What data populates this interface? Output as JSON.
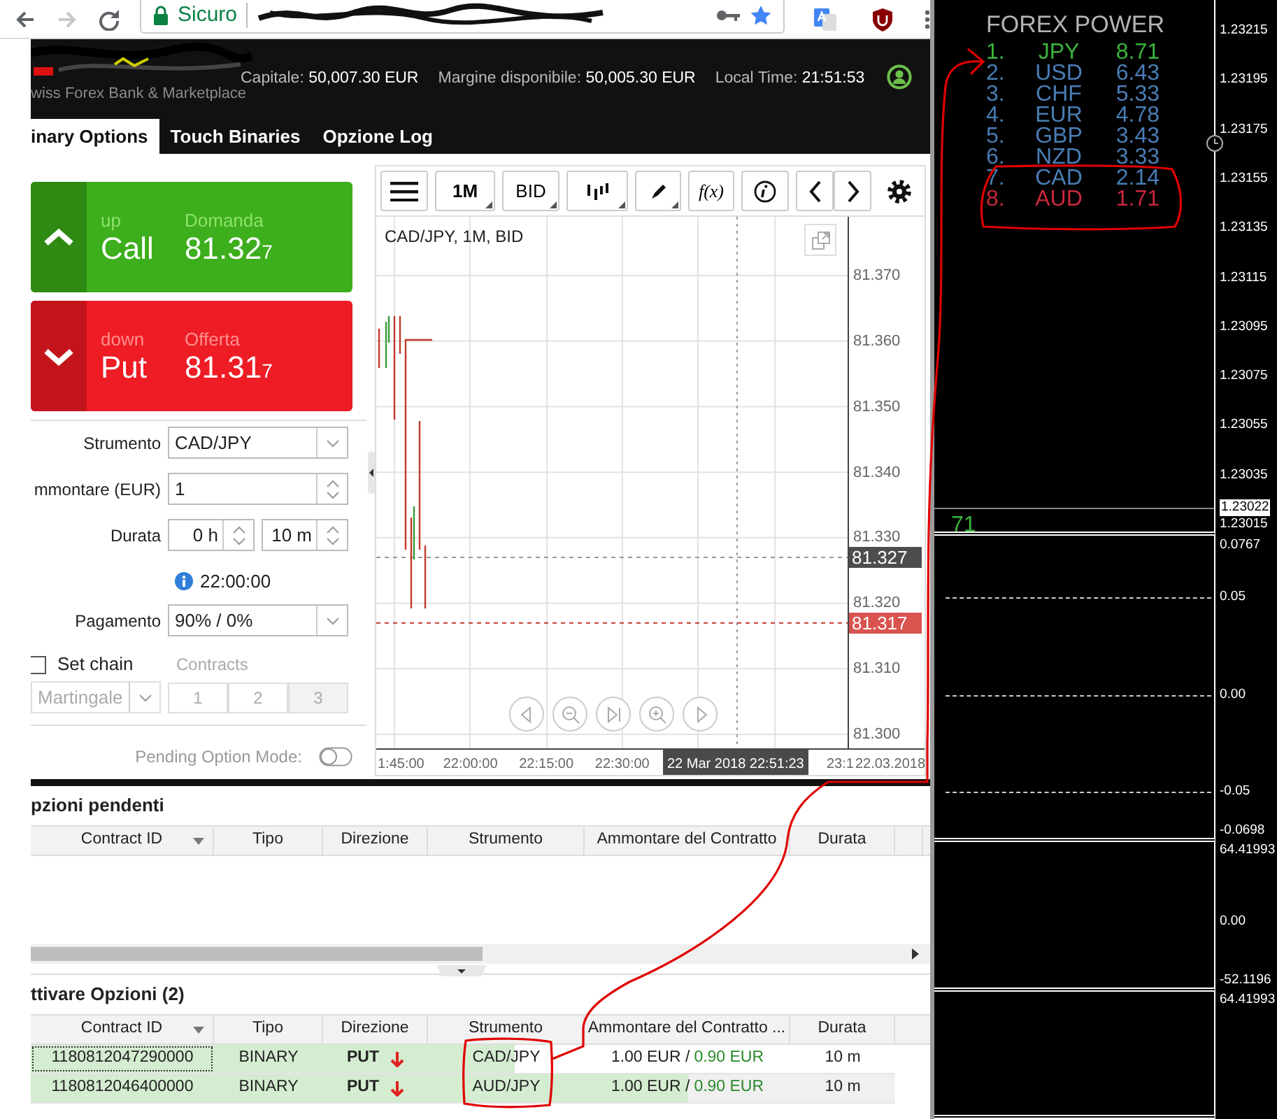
{
  "browser": {
    "security_label": "Sicuro"
  },
  "header": {
    "subtitle": "wiss Forex Bank & Marketplace",
    "stats": [
      {
        "label": "Capitale:",
        "value": "50,007.30 EUR"
      },
      {
        "label": "Margine disponibile:",
        "value": "50,005.30 EUR"
      },
      {
        "label": "Local Time:",
        "value": "21:51:53"
      }
    ]
  },
  "tabs": [
    {
      "label": "inary Options",
      "selected": true
    },
    {
      "label": "Touch Binaries",
      "selected": false
    },
    {
      "label": "Opzione Log",
      "selected": false
    }
  ],
  "trade_buttons": [
    {
      "kind": "call",
      "hint": "up",
      "label": "Call",
      "price_label": "Domanda",
      "price": "81.32",
      "pip": "7"
    },
    {
      "kind": "put",
      "hint": "down",
      "label": "Put",
      "price_label": "Offerta",
      "price": "81.31",
      "pip": "7"
    }
  ],
  "form": {
    "instrument": {
      "label": "Strumento",
      "value": "CAD/JPY"
    },
    "amount": {
      "label": "mmontare (EUR)",
      "value": "1"
    },
    "duration": {
      "label": "Durata",
      "hours": "0 h",
      "minutes": "10 m"
    },
    "expiry": "22:00:00",
    "payout": {
      "label": "Pagamento",
      "value": "90% / 0%"
    },
    "set_chain": {
      "label": "Set chain",
      "checked": false
    },
    "contracts": {
      "label": "Contracts",
      "disabled": true,
      "options": [
        {
          "label": "1",
          "selected": false
        },
        {
          "label": "2",
          "selected": false
        },
        {
          "label": "3",
          "selected": true
        }
      ]
    },
    "martingale": {
      "value": "Martingale",
      "disabled": true
    },
    "pending_mode": {
      "label": "Pending Option Mode:",
      "on": false
    }
  },
  "chart": {
    "toolbar": {
      "period": "1M",
      "price_type": "BID",
      "function": "f(x)"
    },
    "legend": "CAD/JPY, 1M, BID",
    "y_labels": [
      "81.370",
      "81.360",
      "81.350",
      "81.340",
      "81.330",
      "81.320",
      "81.310",
      "81.300"
    ],
    "price_markers": [
      {
        "kind": "ask",
        "label": "81.327"
      },
      {
        "kind": "bid",
        "label": "81.317"
      }
    ],
    "x_labels": [
      "1:45:00",
      "22:00:00",
      "22:15:00",
      "22:30:00"
    ],
    "cursor_time": "22 Mar 2018 22:51:23",
    "x_tail": [
      "23:1",
      "22.03.2018"
    ]
  },
  "pending": {
    "title": "pzioni pendenti",
    "columns": [
      "Contract ID",
      "Tipo",
      "Direzione",
      "Strumento",
      "Ammontare del Contratto",
      "Durata"
    ]
  },
  "active": {
    "title": "ttivare Opzioni (2)",
    "columns": [
      "Contract ID",
      "Tipo",
      "Direzione",
      "Strumento",
      "Ammontare del Contratto ...",
      "Durata"
    ],
    "rows": [
      {
        "contract_id": "1180812047290000",
        "type": "BINARY",
        "direction": "PUT",
        "falling": true,
        "instrument": "CAD/JPY",
        "amount": "1.00 EUR /",
        "payout": "0.90 EUR",
        "duration": "10 m",
        "level": 0.56,
        "selected": true
      },
      {
        "contract_id": "1180812046400000",
        "type": "BINARY",
        "direction": "PUT",
        "falling": true,
        "instrument": "AUD/JPY",
        "amount": "1.00 EUR /",
        "payout": "0.90 EUR",
        "duration": "10 m",
        "level": 0.76,
        "selected": false
      }
    ]
  },
  "forex_power": {
    "title": "FOREX POWER",
    "ranks": [
      {
        "rank": "1.",
        "currency": "JPY",
        "value": "8.71",
        "color": "#3cb43c"
      },
      {
        "rank": "2.",
        "currency": "USD",
        "value": "6.43",
        "color": "#4a7db4"
      },
      {
        "rank": "3.",
        "currency": "CHF",
        "value": "5.33",
        "color": "#4a7db4"
      },
      {
        "rank": "4.",
        "currency": "EUR",
        "value": "4.78",
        "color": "#4a7db4"
      },
      {
        "rank": "5.",
        "currency": "GBP",
        "value": "3.43",
        "color": "#4a7db4"
      },
      {
        "rank": "6.",
        "currency": "NZD",
        "value": "3.33",
        "color": "#4a7db4"
      },
      {
        "rank": "7.",
        "currency": "CAD",
        "value": "2.14",
        "color": "#4a7db4"
      },
      {
        "rank": "8.",
        "currency": "AUD",
        "value": "1.71",
        "color": "#c8283c"
      }
    ]
  },
  "terminal": {
    "panes": [
      {
        "reading": "71",
        "ticks": [
          {
            "label": "1.23215",
            "kind": "tick"
          },
          {
            "label": "1.23195",
            "kind": "tick"
          },
          {
            "label": "1.23175",
            "kind": "tick"
          },
          {
            "label": "1.23155",
            "kind": "tick"
          },
          {
            "label": "1.23135",
            "kind": "tick"
          },
          {
            "label": "1.23115",
            "kind": "tick"
          },
          {
            "label": "1.23095",
            "kind": "tick"
          },
          {
            "label": "1.23075",
            "kind": "tick"
          },
          {
            "label": "1.23055",
            "kind": "tick"
          },
          {
            "label": "1.23035",
            "kind": "tick"
          },
          {
            "label": "1.23022",
            "kind": "current"
          },
          {
            "label": "1.23015",
            "kind": "tick"
          }
        ]
      },
      {
        "ticks": [
          {
            "label": "0.0767",
            "kind": "tick"
          },
          {
            "label": "0.05",
            "kind": "level"
          },
          {
            "label": "0.00",
            "kind": "level"
          },
          {
            "label": "-0.05",
            "kind": "level"
          },
          {
            "label": "-0.0698",
            "kind": "tick"
          }
        ]
      },
      {
        "ticks": [
          {
            "label": "64.41993",
            "kind": "tick"
          },
          {
            "label": "0.00",
            "kind": "tick"
          },
          {
            "label": "-52.1196",
            "kind": "tick"
          }
        ]
      },
      {
        "ticks": [
          {
            "label": "64.41993",
            "kind": "tick"
          }
        ]
      }
    ]
  }
}
